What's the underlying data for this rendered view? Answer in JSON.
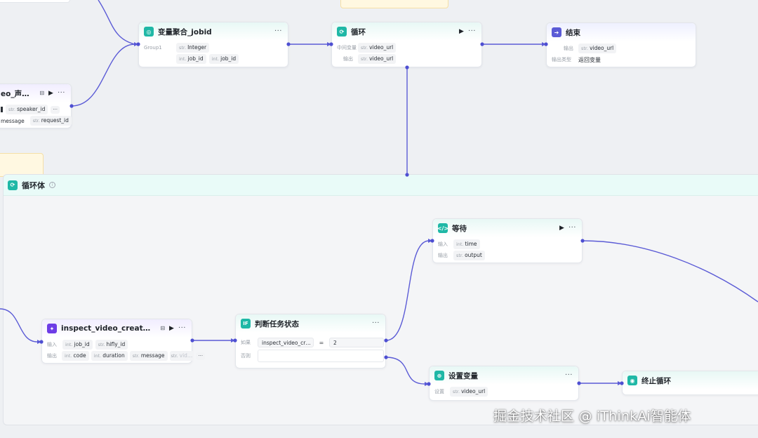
{
  "loop_body": {
    "title": "循环体",
    "info_icon": "info-icon"
  },
  "nodes": {
    "var_agg": {
      "title": "变量聚合_jobid",
      "icon": "variable-aggregate-icon",
      "group_label": "Group1",
      "tag1_type": "str.",
      "tag1": "Integer",
      "tag2_type": "int.",
      "tag2": "job_id",
      "tag3_type": "int.",
      "tag3": "job_id"
    },
    "loop": {
      "title": "循环",
      "icon": "loop-icon",
      "row1_label": "中间变量",
      "row1_type": "str.",
      "row1_value": "video_url",
      "row2_label": "输出",
      "row2_type": "str.",
      "row2_value": "video_url"
    },
    "end": {
      "title": "结束",
      "icon": "end-icon",
      "row1_label": "输出",
      "row1_type": "str.",
      "row1_value": "video_url",
      "row2_label": "输出类型",
      "row2_value": "返回变量"
    },
    "voice": {
      "title": "eo_声音…",
      "row1_type": "str.",
      "row1_value": "speaker_id",
      "row1_more": "···",
      "row2_value_a": "message",
      "row2_type_b": "str.",
      "row2_value_b": "request_id"
    },
    "wait": {
      "title": "等待",
      "icon": "code-icon",
      "row1_label": "输入",
      "row1_type": "int.",
      "row1_value": "time",
      "row2_label": "输出",
      "row2_type": "str.",
      "row2_value": "output"
    },
    "inspect": {
      "title": "inspect_video_creation_sta…",
      "icon": "plugin-icon",
      "row1_label": "输入",
      "row1_type_a": "int.",
      "row1_value_a": "job_id",
      "row1_type_b": "str.",
      "row1_value_b": "hifly_id",
      "row2_label": "输出",
      "row2_type_a": "int.",
      "row2_value_a": "code",
      "row2_type_b": "int.",
      "row2_value_b": "duration",
      "row2_type_c": "str.",
      "row2_value_c": "message",
      "row2_type_d": "str.",
      "row2_value_d": "vid…",
      "row2_more": "···"
    },
    "judge": {
      "title": "判断任务状态",
      "icon_text": "IF",
      "row1_label": "如果",
      "row1_field": "inspect_video_cr…",
      "row1_op": "=",
      "row1_value": "2",
      "row2_label": "否则"
    },
    "setvar": {
      "title": "设置变量",
      "icon": "set-variable-icon",
      "row1_label": "设置",
      "row1_type": "str.",
      "row1_value": "video_url"
    },
    "stop": {
      "title": "终止循环",
      "icon": "stop-loop-icon"
    }
  },
  "watermark": "掘金技术社区 @ iThinkAi智能体",
  "colors": {
    "edge": "#5b5bd6",
    "teal_icon": "#1fb8a6",
    "purple_icon": "#6d3ce6",
    "indigo_icon": "#5b5bd6",
    "canvas_bg": "#eef0f3",
    "note_bg": "#fff8e1"
  }
}
